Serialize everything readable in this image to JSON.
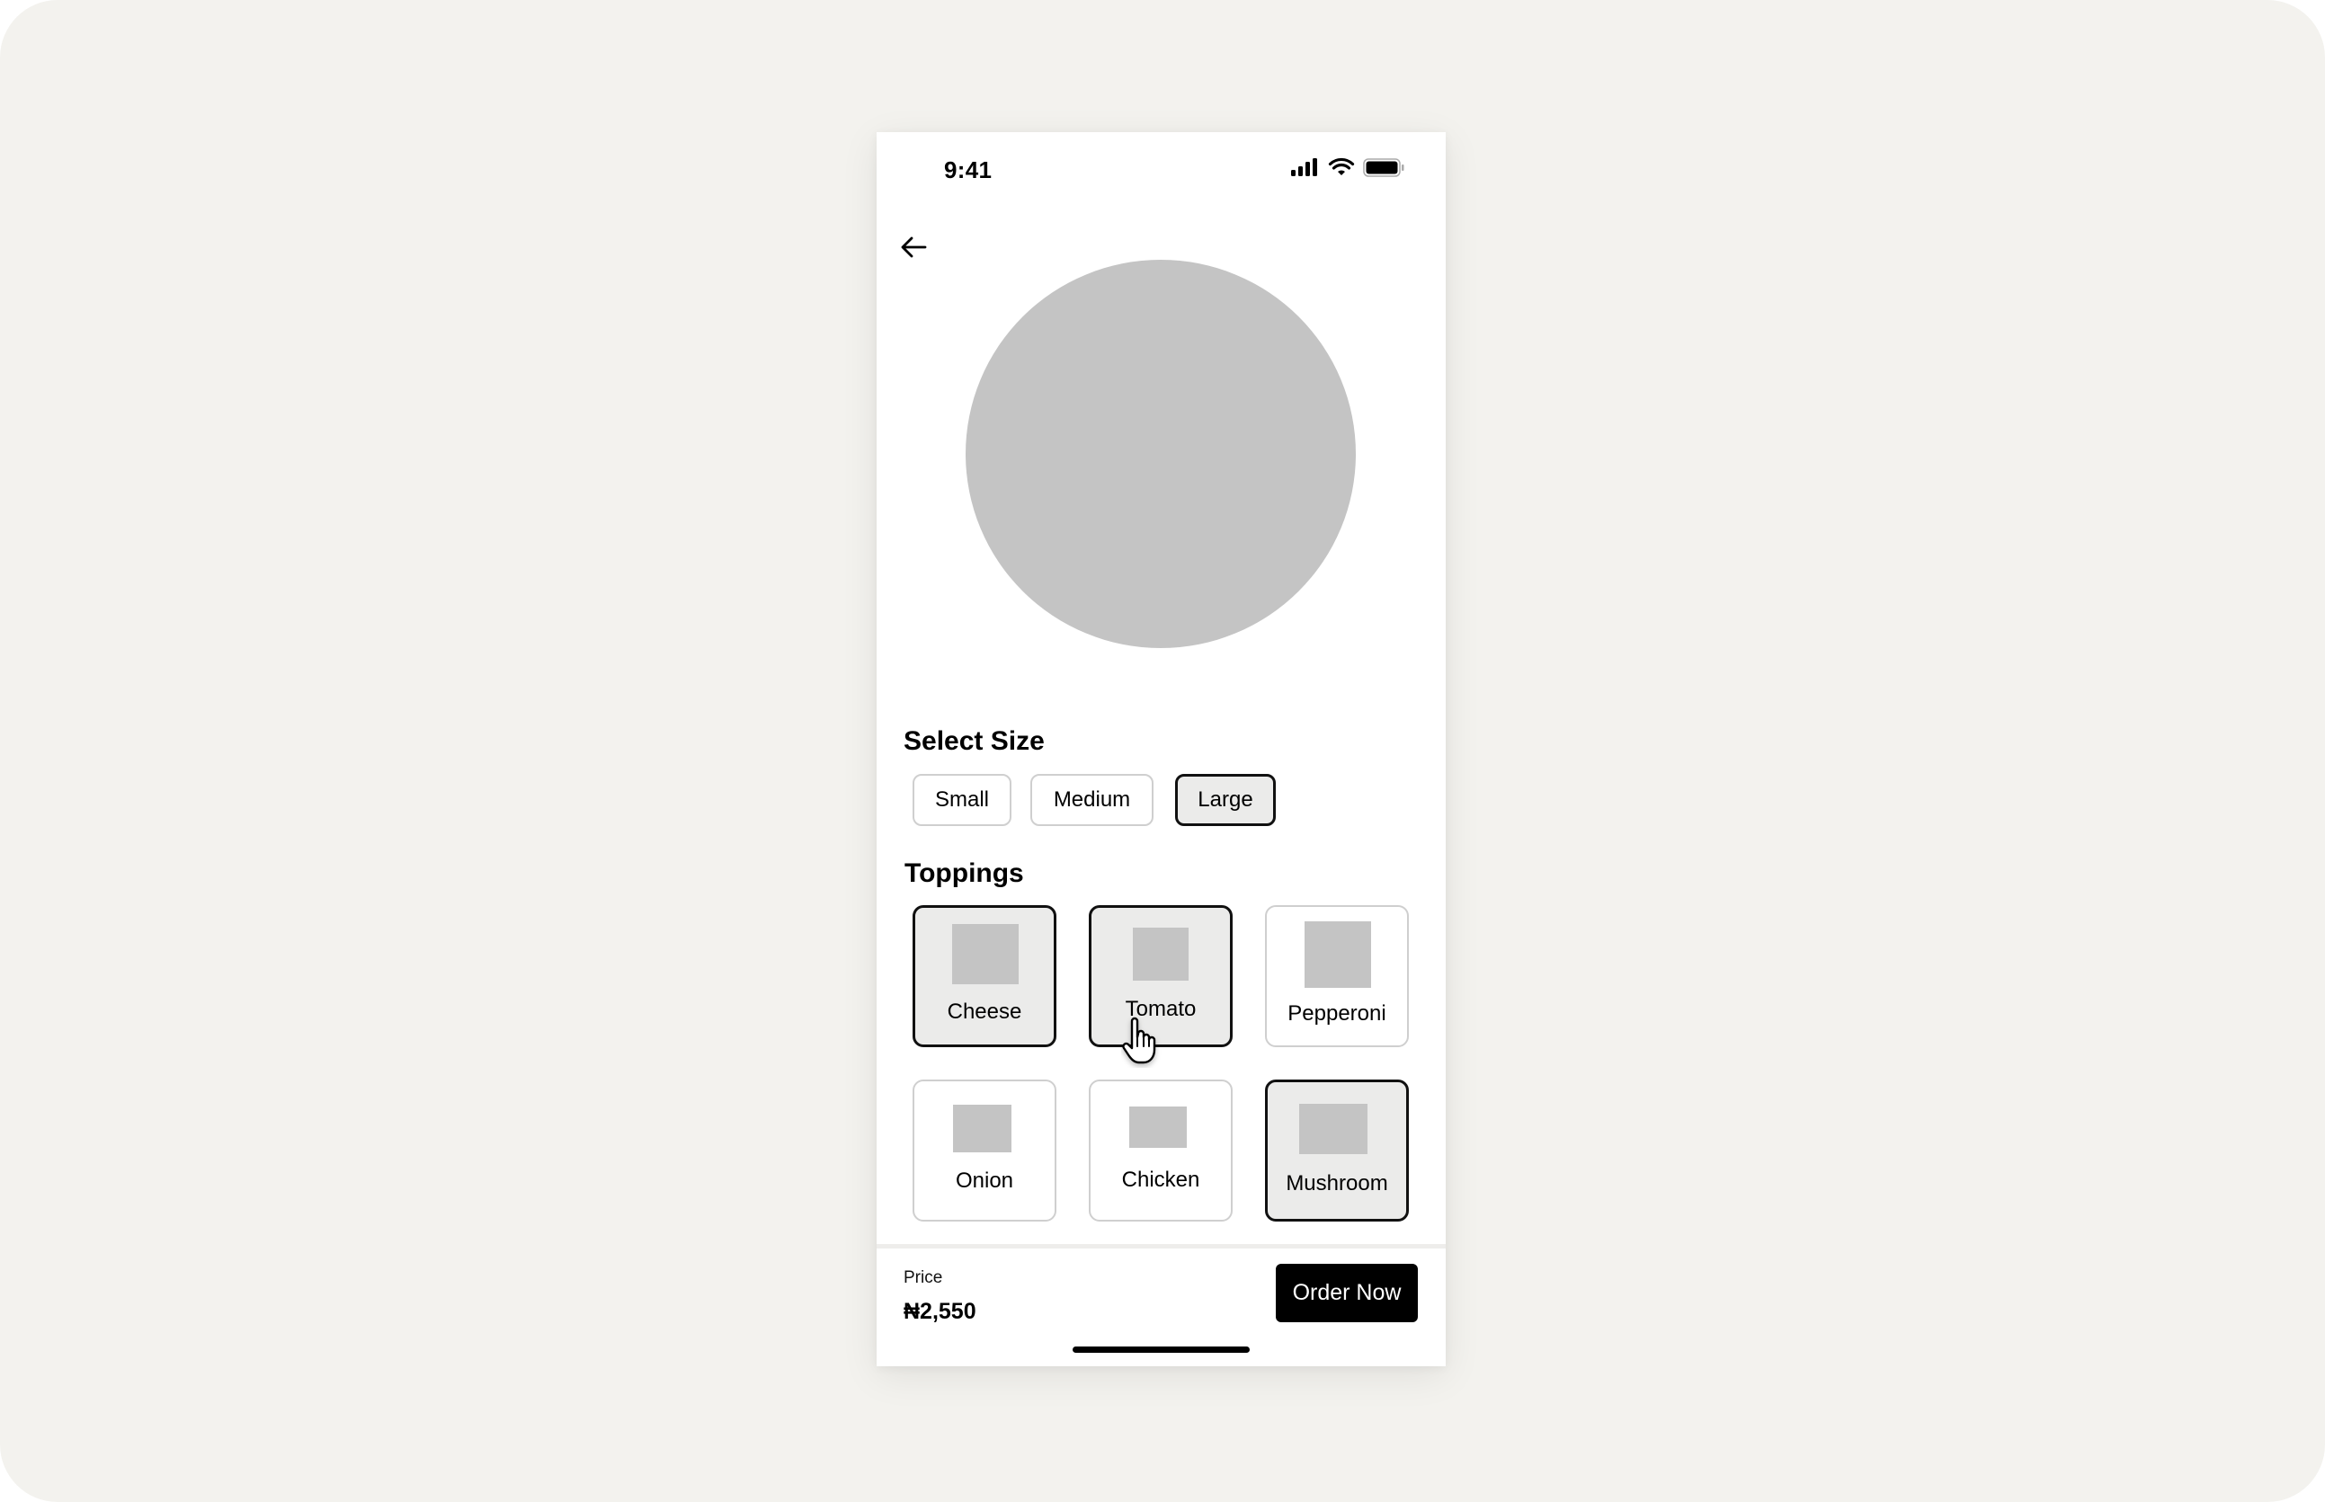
{
  "status_bar": {
    "time": "9:41",
    "icons": [
      "cellular-signal-icon",
      "wifi-icon",
      "battery-icon"
    ]
  },
  "nav": {
    "back_icon": "arrow-left-icon"
  },
  "hero": {
    "placeholder": "pizza-image-placeholder"
  },
  "size": {
    "title": "Select Size",
    "options": [
      {
        "label": "Small",
        "selected": false
      },
      {
        "label": "Medium",
        "selected": false
      },
      {
        "label": "Large",
        "selected": true
      }
    ]
  },
  "toppings": {
    "title": "Toppings",
    "items": [
      {
        "label": "Cheese",
        "selected": true
      },
      {
        "label": "Tomato",
        "selected": true
      },
      {
        "label": "Pepperoni",
        "selected": false
      },
      {
        "label": "Onion",
        "selected": false
      },
      {
        "label": "Chicken",
        "selected": false
      },
      {
        "label": "Mushroom",
        "selected": true
      }
    ]
  },
  "footer": {
    "price_label": "Price",
    "price_value": "₦2,550",
    "order_button": "Order Now"
  },
  "colors": {
    "background": "#f3f2ee",
    "placeholder_gray": "#c4c4c4",
    "selected_fill": "#ebebea",
    "primary_button": "#000000"
  },
  "cursor": {
    "type": "hand-pointer-icon"
  }
}
